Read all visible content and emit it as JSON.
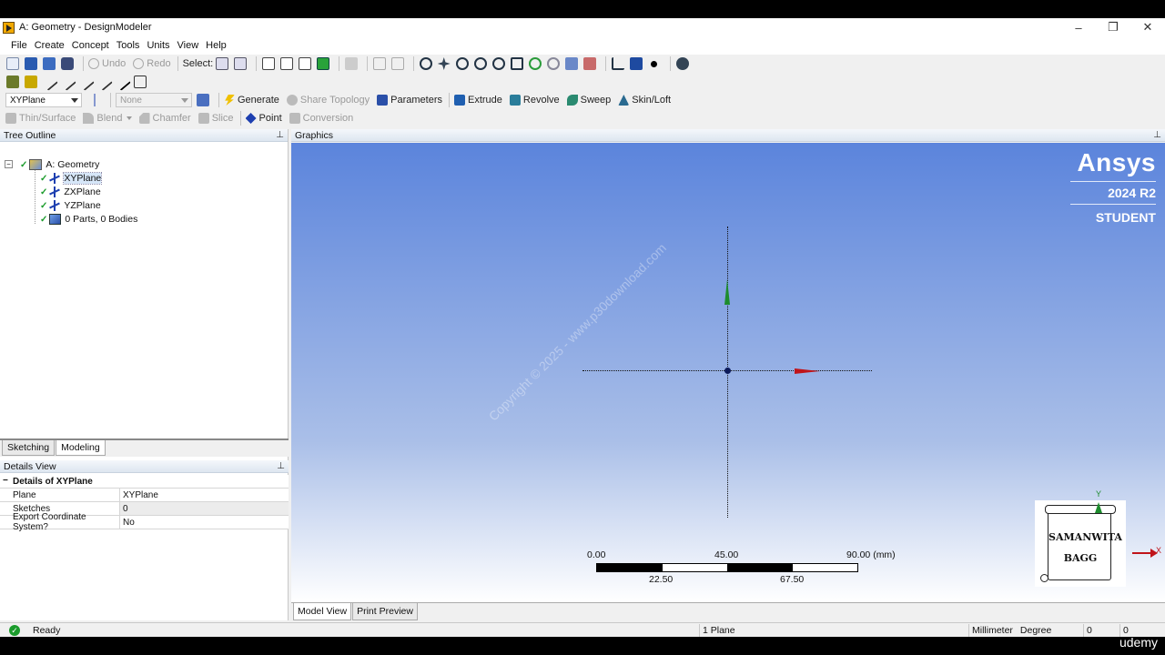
{
  "window": {
    "title": "A: Geometry - DesignModeler"
  },
  "menu": [
    "File",
    "Create",
    "Concept",
    "Tools",
    "Units",
    "View",
    "Help"
  ],
  "toolbar1": {
    "undo": "Undo",
    "redo": "Redo",
    "select": "Select:"
  },
  "toolbar3": {
    "plane_select": "XYPlane",
    "sketch_select": "None",
    "generate": "Generate",
    "share_topology": "Share Topology",
    "parameters": "Parameters",
    "extrude": "Extrude",
    "revolve": "Revolve",
    "sweep": "Sweep",
    "skin_loft": "Skin/Loft"
  },
  "toolbar4": {
    "thin_surface": "Thin/Surface",
    "blend": "Blend",
    "chamfer": "Chamfer",
    "slice": "Slice",
    "point": "Point",
    "conversion": "Conversion"
  },
  "tree": {
    "title": "Tree Outline",
    "root": "A: Geometry",
    "items": [
      "XYPlane",
      "ZXPlane",
      "YZPlane",
      "0 Parts, 0 Bodies"
    ]
  },
  "sub_tabs": [
    "Sketching",
    "Modeling"
  ],
  "details": {
    "title": "Details View",
    "group": "Details of XYPlane",
    "rows": [
      {
        "key": "Plane",
        "value": "XYPlane"
      },
      {
        "key": "Sketches",
        "value": "0"
      },
      {
        "key": "Export Coordinate System?",
        "value": "No"
      }
    ]
  },
  "graphics": {
    "title": "Graphics",
    "brand": {
      "name": "Ansys",
      "version": "2024 R2",
      "edition": "STUDENT"
    },
    "watermark": "Copyright © 2025 - www.p30download.com",
    "scale": {
      "top": [
        "0.00",
        "45.00",
        "90.00 (mm)"
      ],
      "bottom": [
        "22.50",
        "67.50"
      ]
    },
    "triad": {
      "y": "Y",
      "x": "X"
    },
    "logo": {
      "line1": "SAMANWITA",
      "line2": "BAGG"
    }
  },
  "view_tabs": [
    "Model View",
    "Print Preview"
  ],
  "status": {
    "text": "Ready",
    "selection": "1 Plane",
    "length_unit": "Millimeter",
    "angle_unit": "Degree",
    "v1": "0",
    "v2": "0"
  },
  "overlay": {
    "udemy": "udemy"
  },
  "colors": {
    "viewport_top": "#5b84dc",
    "y_axis": "#1d8c2d",
    "x_axis": "#c0141a",
    "ok": "#1a9b2b"
  }
}
